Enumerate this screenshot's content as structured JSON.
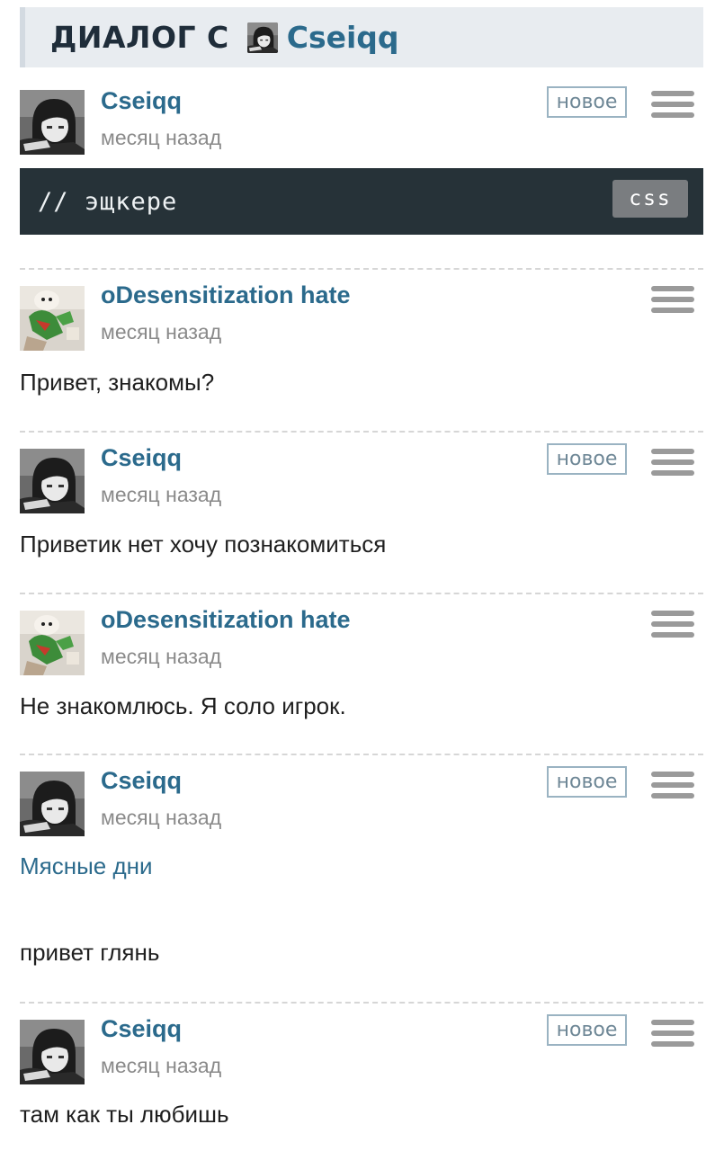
{
  "header": {
    "title": "ДИАЛОГ С",
    "user": "Cseiqq"
  },
  "code_block": {
    "code": "// эщкере",
    "lang": "css"
  },
  "posts": [
    {
      "user": "Cseiqq",
      "time": "месяц назад",
      "badge": "новое",
      "avatar": "girl-avatar"
    },
    {
      "user": "oDesensitization hate",
      "time": "месяц назад",
      "text": "Привет, знакомы?",
      "avatar": "dino-avatar"
    },
    {
      "user": "Cseiqq",
      "time": "месяц назад",
      "badge": "новое",
      "text": "Приветик нет хочу познакомиться",
      "avatar": "girl-avatar"
    },
    {
      "user": "oDesensitization hate",
      "time": "месяц назад",
      "text": "Не знакомлюсь. Я соло игрок.",
      "avatar": "dino-avatar"
    },
    {
      "user": "Cseiqq",
      "time": "месяц назад",
      "badge": "новое",
      "link": "Мясные дни",
      "text": "привет глянь",
      "avatar": "girl-avatar"
    },
    {
      "user": "Cseiqq",
      "time": "месяц назад",
      "badge": "новое",
      "text": "там как ты любишь",
      "avatar": "girl-avatar"
    }
  ],
  "colors": {
    "link": "#2b6a8c",
    "header_bg": "#e8ecf0",
    "code_bg": "#263238",
    "muted": "#8a8a8a"
  }
}
